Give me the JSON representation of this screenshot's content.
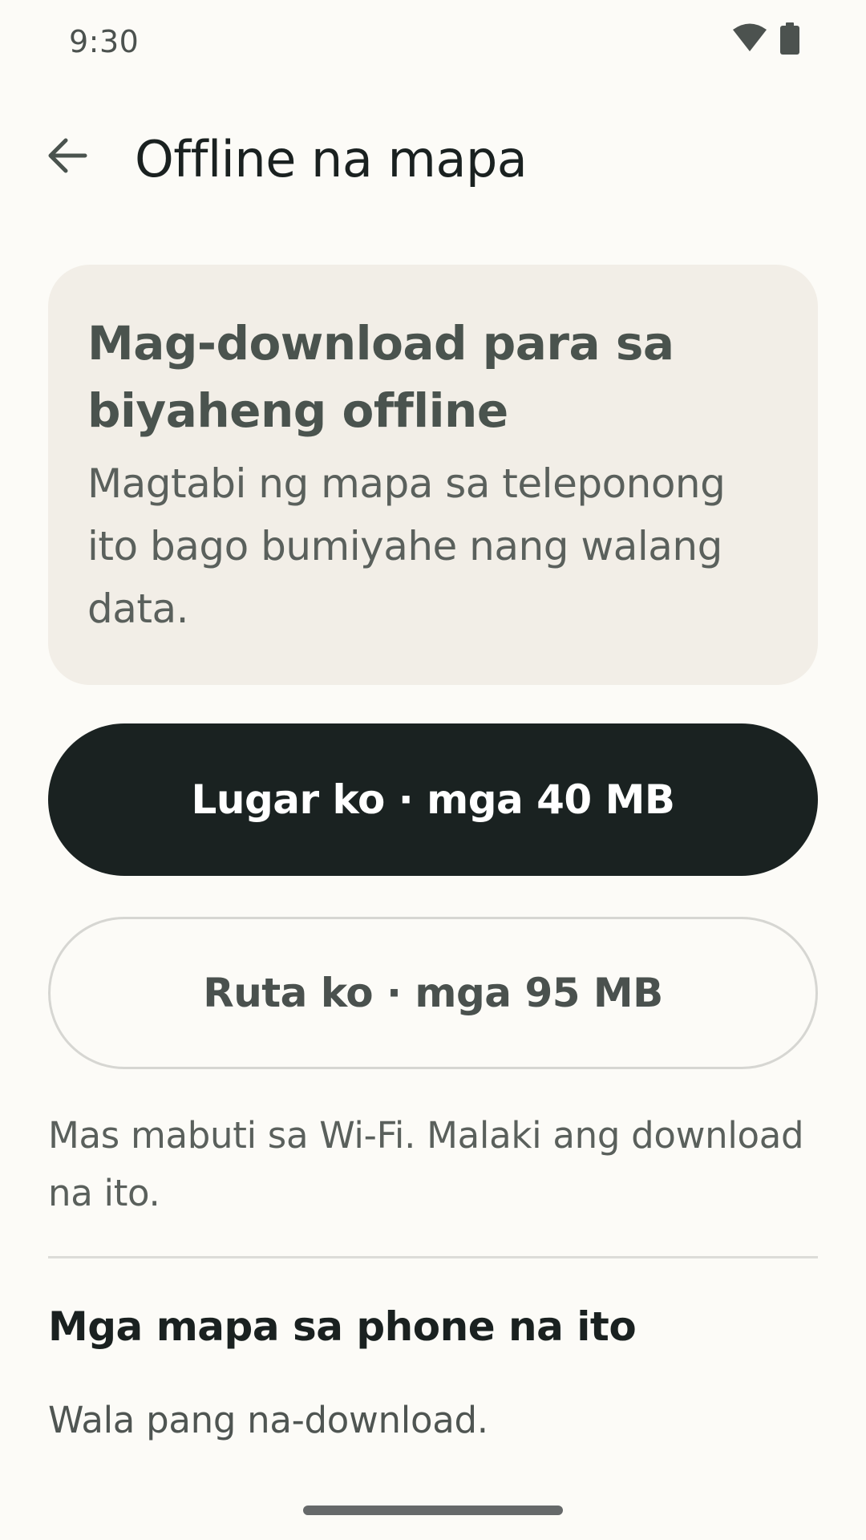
{
  "status_bar": {
    "time": "9:30",
    "icons": [
      "wifi-icon",
      "battery-icon"
    ]
  },
  "app_bar": {
    "back_icon": "arrow-back-icon",
    "title": "Offline na mapa"
  },
  "info_card": {
    "title": "Mag-download para sa biyaheng offline",
    "body": "Magtabi ng mapa sa teleponong ito bago bumiyahe nang walang data."
  },
  "actions": {
    "primary_label": "Lugar ko · mga 40 MB",
    "secondary_label": "Ruta ko · mga 95 MB"
  },
  "note": "Mas mabuti sa Wi-Fi. Malaki ang download na ito.",
  "downloaded_section": {
    "title": "Mga mapa sa phone na ito",
    "empty_text": "Wala pang na-download."
  },
  "colors": {
    "background": "#FCFBF7",
    "card": "#F2EEE7",
    "primary_button": "#1A2221",
    "text_dark": "#1A2120"
  }
}
